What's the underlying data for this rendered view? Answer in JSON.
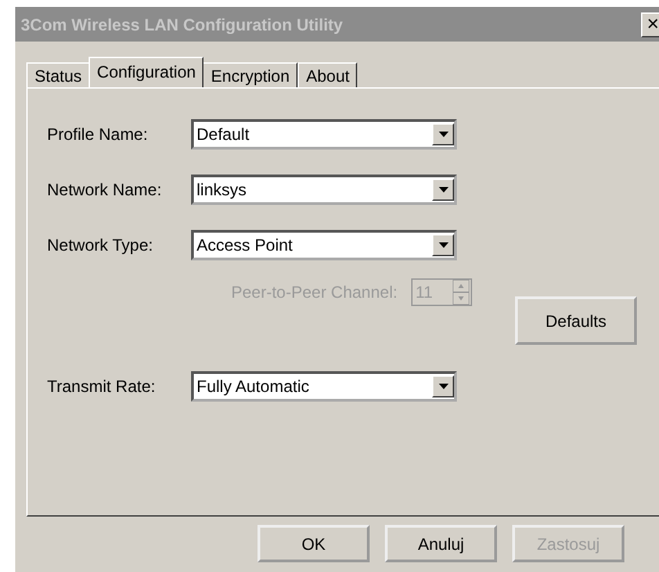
{
  "window": {
    "title": "3Com Wireless LAN Configuration Utility",
    "close": "×"
  },
  "tabs": [
    {
      "label": "Status",
      "selected": false
    },
    {
      "label": "Configuration",
      "selected": true
    },
    {
      "label": "Encryption",
      "selected": false
    },
    {
      "label": "About",
      "selected": false
    }
  ],
  "fields": [
    {
      "kind": "dropdown",
      "label": "Profile Name:",
      "value": "Default"
    },
    {
      "kind": "dropdown",
      "label": "Network Name:",
      "value": "linksys"
    },
    {
      "kind": "dropdown",
      "label": "Network Type:",
      "value": "Access Point"
    },
    {
      "kind": "spinner",
      "label": "Peer-to-Peer Channel:",
      "value": "11",
      "disabled": true
    },
    {
      "kind": "dropdown",
      "label": "Transmit Rate:",
      "value": "Fully Automatic"
    }
  ],
  "defaults_button": "Defaults",
  "buttons": [
    {
      "label": "OK",
      "disabled": false
    },
    {
      "label": "Anuluj",
      "disabled": false
    },
    {
      "label": "Zastosuj",
      "disabled": true
    }
  ]
}
